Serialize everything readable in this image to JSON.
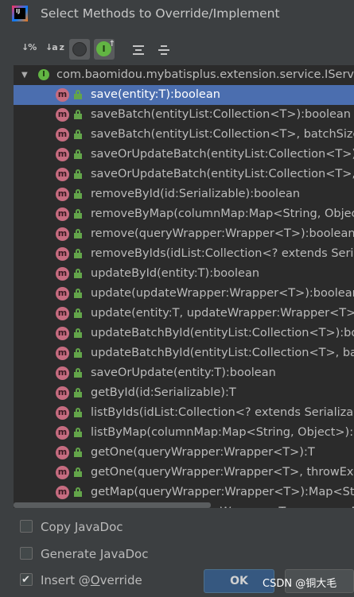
{
  "window": {
    "title": "Select Methods to Override/Implement",
    "logo_text": "IJ"
  },
  "toolbar": {
    "sort_by_visibility_label": "↓%",
    "sort_alpha_label": "↓a z",
    "show_classes_icon": "circle-icon",
    "show_interfaces_label": "I",
    "expand_all_icon": "expand-all-icon",
    "collapse_all_icon": "collapse-all-icon"
  },
  "tree": {
    "class_icon_label": "I",
    "method_icon_label": "m",
    "class_name": "com.baomidou.mybatisplus.extension.service.IService",
    "methods": [
      "save(entity:T):boolean",
      "saveBatch(entityList:Collection<T>):boolean",
      "saveBatch(entityList:Collection<T>, batchSize:int):boolean",
      "saveOrUpdateBatch(entityList:Collection<T>):boolean",
      "saveOrUpdateBatch(entityList:Collection<T>, batchSize:int):boolean",
      "removeById(id:Serializable):boolean",
      "removeByMap(columnMap:Map<String, Object>):boolean",
      "remove(queryWrapper:Wrapper<T>):boolean",
      "removeByIds(idList:Collection<? extends Serializable>):boolean",
      "updateById(entity:T):boolean",
      "update(updateWrapper:Wrapper<T>):boolean",
      "update(entity:T, updateWrapper:Wrapper<T>):boolean",
      "updateBatchById(entityList:Collection<T>):boolean",
      "updateBatchById(entityList:Collection<T>, batchSize:int):boolean",
      "saveOrUpdate(entity:T):boolean",
      "getById(id:Serializable):T",
      "listByIds(idList:Collection<? extends Serializable>):List<T>",
      "listByMap(columnMap:Map<String, Object>):List<T>",
      "getOne(queryWrapper:Wrapper<T>):T",
      "getOne(queryWrapper:Wrapper<T>, throwEx:boolean):T",
      "getMap(queryWrapper:Wrapper<T>):Map<String, Object>",
      "getObj(queryWrapper:Wrapper<T>, mapper:Function):V"
    ]
  },
  "options": {
    "copy_javadoc_pre": "Copy ",
    "copy_javadoc_mn": "J",
    "copy_javadoc_post": "avaDoc",
    "generate_javadoc": "Generate JavaDoc",
    "insert_override_pre": "Insert @",
    "insert_override_mn": "O",
    "insert_override_post": "verride"
  },
  "buttons": {
    "ok": "OK"
  },
  "watermark": "CSDN @铜大毛"
}
